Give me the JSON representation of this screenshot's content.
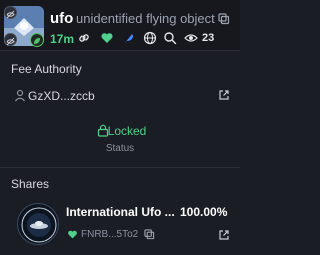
{
  "header": {
    "symbol": "ufo",
    "name": "unidentified flying object",
    "age": "17m",
    "holders_count": "23",
    "icons": [
      "link-icon",
      "heart-icon",
      "feather-icon",
      "globe-icon",
      "search-icon",
      "eye-icon",
      "copy-icon"
    ],
    "accent_color": "#4fd18b"
  },
  "fee_authority": {
    "title": "Fee Authority",
    "address": "GzXD...zccb"
  },
  "lock": {
    "state": "Locked",
    "status_label": "Status"
  },
  "shares": {
    "title": "Shares",
    "items": [
      {
        "name": "International Ufo ...",
        "percent": "100.00%",
        "address": "FNRB...5To2"
      }
    ]
  }
}
